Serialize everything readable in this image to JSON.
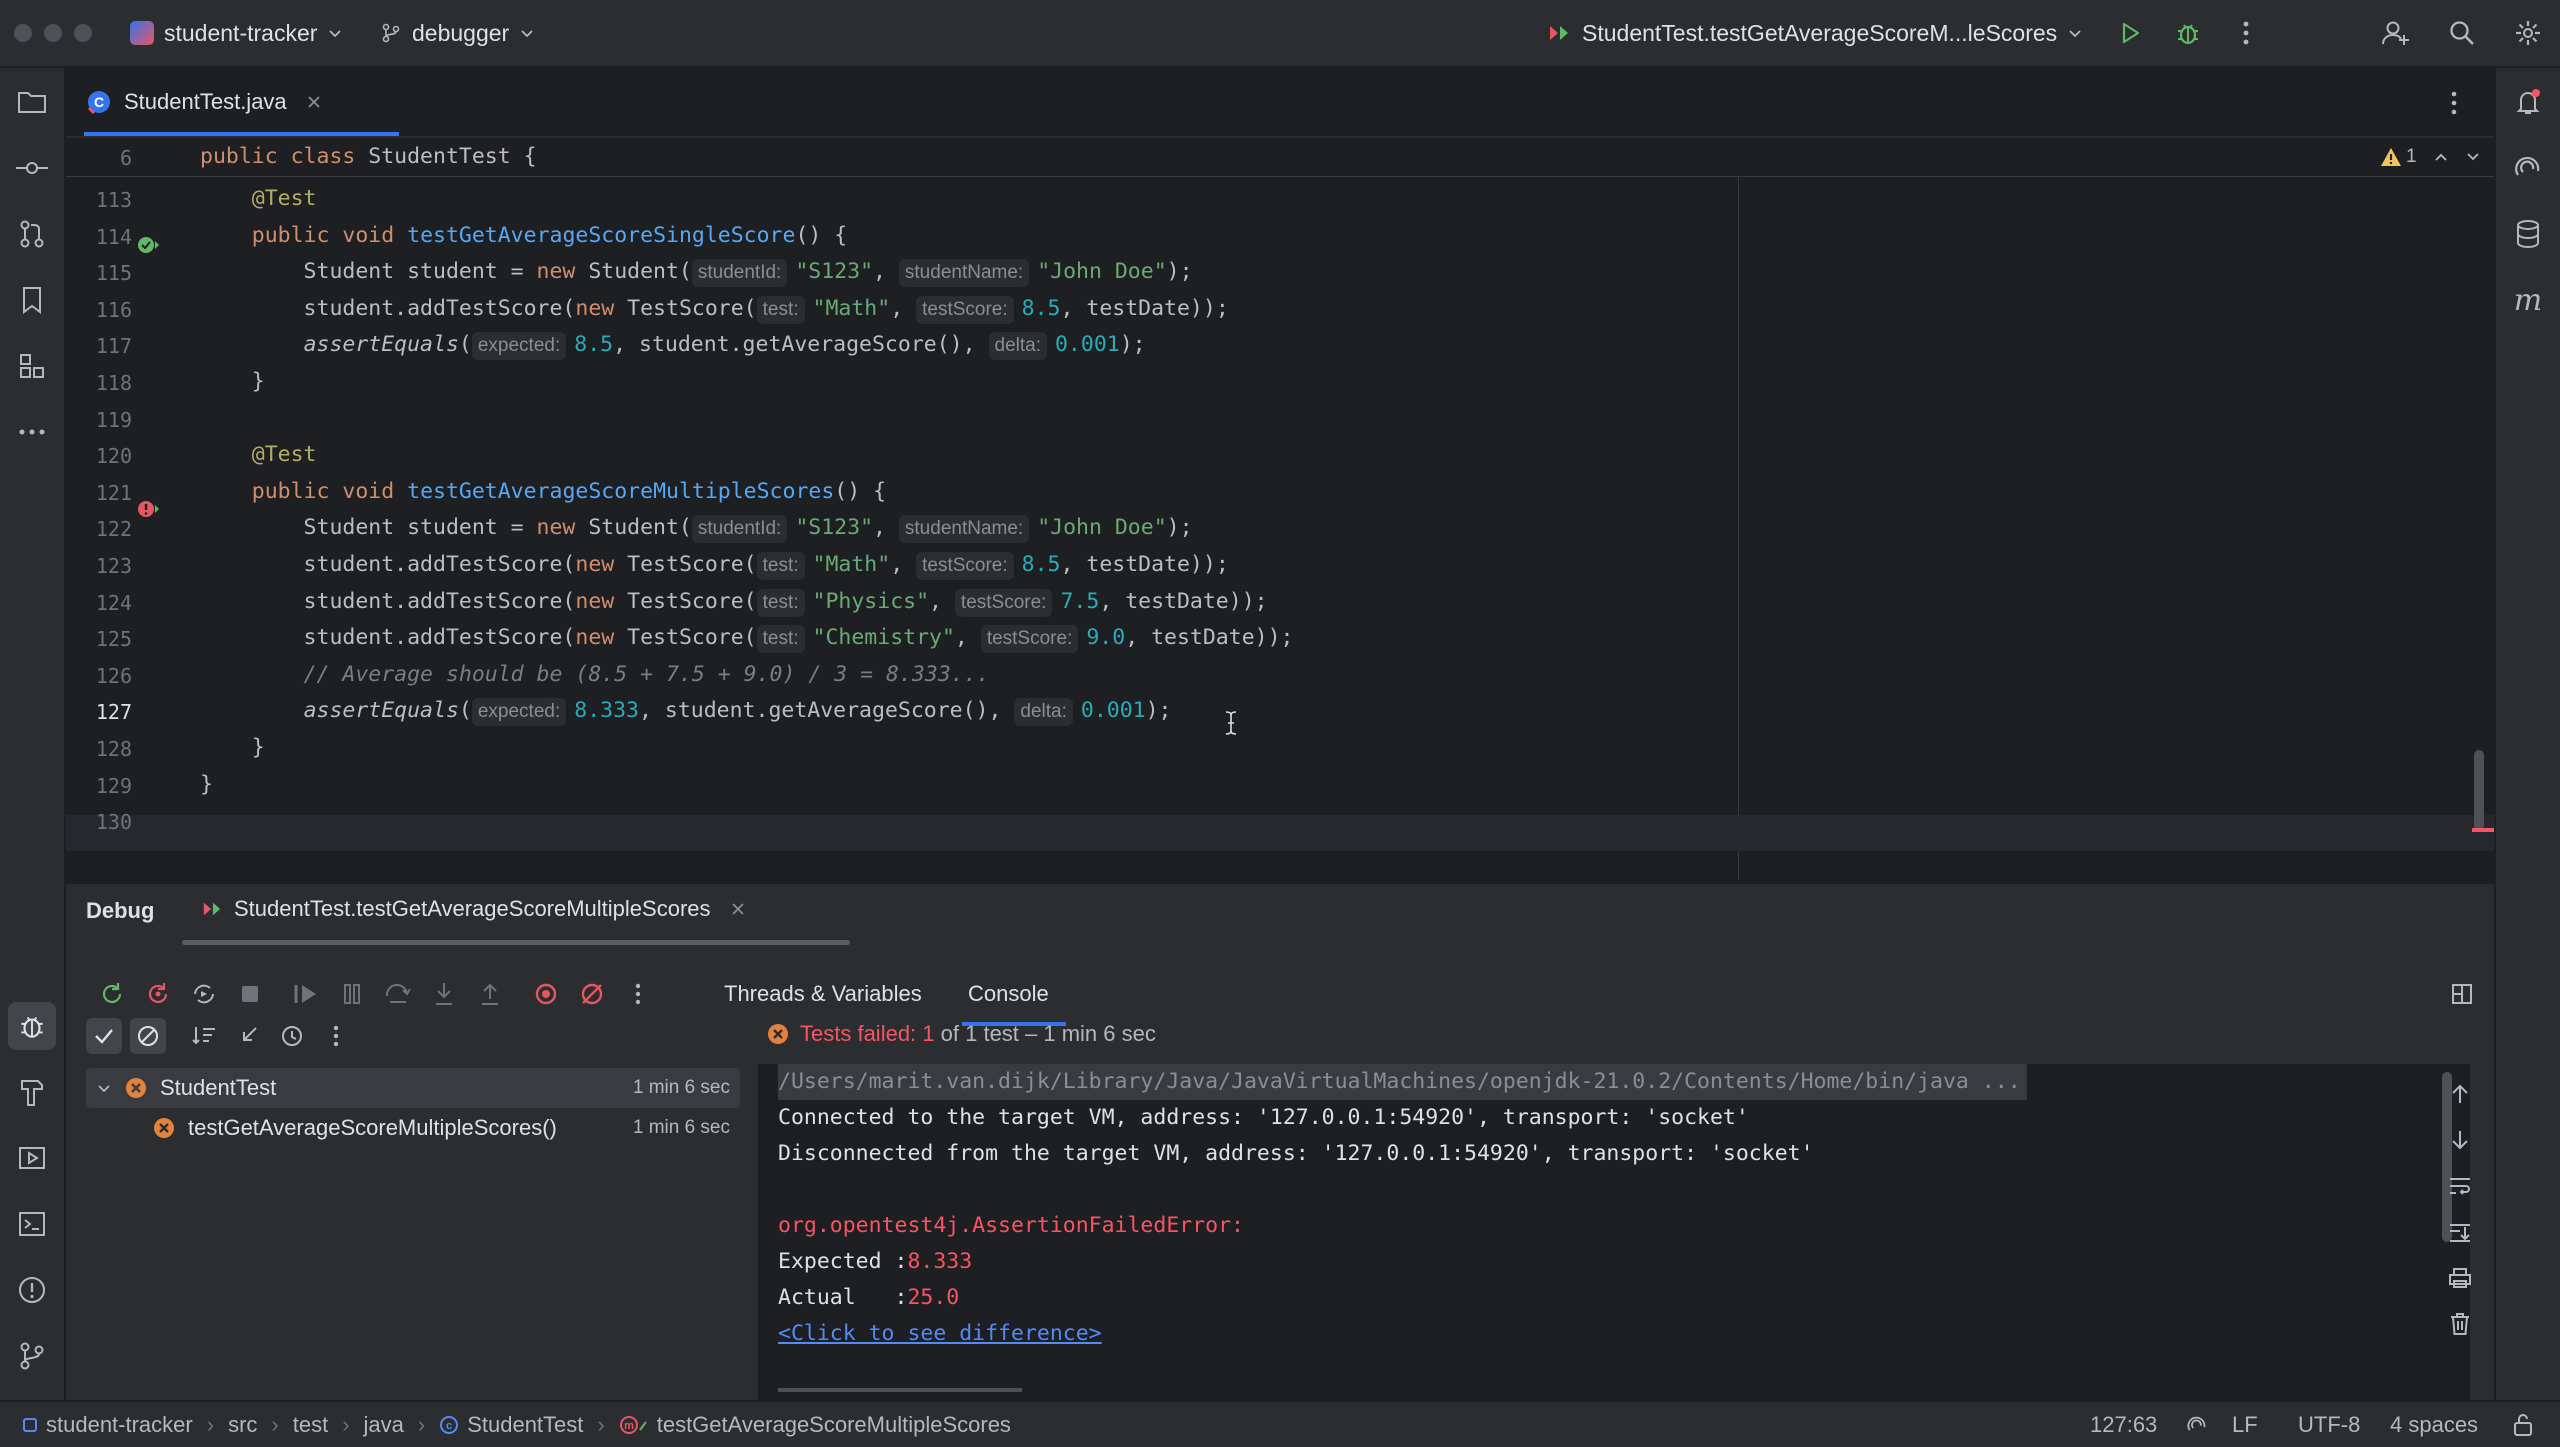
{
  "titlebar": {
    "project": "student-tracker",
    "project_badge": "ST",
    "branch": "debugger",
    "run_config": "StudentTest.testGetAverageScoreM...leScores"
  },
  "editor_tab": {
    "filename": "StudentTest.java"
  },
  "editor": {
    "sticky_line_number": "6",
    "sticky_code": [
      {
        "t": "public ",
        "c": "kw"
      },
      {
        "t": "class ",
        "c": "kw"
      },
      {
        "t": "StudentTest {",
        "c": ""
      }
    ],
    "problems_count": "1",
    "lines": [
      {
        "n": "113",
        "tokens": [
          {
            "t": "    "
          },
          {
            "t": "@Test",
            "c": "ann"
          }
        ]
      },
      {
        "n": "114",
        "tokens": [
          {
            "t": "    "
          },
          {
            "t": "public ",
            "c": "kw"
          },
          {
            "t": "void ",
            "c": "kw"
          },
          {
            "t": "testGetAverageScoreSingleScore",
            "c": "fn"
          },
          {
            "t": "() {"
          }
        ]
      },
      {
        "n": "115",
        "tokens": [
          {
            "t": "        Student student = "
          },
          {
            "t": "new ",
            "c": "kw"
          },
          {
            "t": "Student("
          },
          {
            "h": "studentId:"
          },
          {
            "t": "\"S123\"",
            "c": "str"
          },
          {
            "t": ", "
          },
          {
            "h": "studentName:"
          },
          {
            "t": "\"John Doe\"",
            "c": "str"
          },
          {
            "t": ");"
          }
        ]
      },
      {
        "n": "116",
        "tokens": [
          {
            "t": "        student.addTestScore("
          },
          {
            "t": "new ",
            "c": "kw"
          },
          {
            "t": "TestScore("
          },
          {
            "h": "test:"
          },
          {
            "t": "\"Math\"",
            "c": "str"
          },
          {
            "t": ", "
          },
          {
            "h": "testScore:"
          },
          {
            "t": "8.5",
            "c": "num"
          },
          {
            "t": ", testDate));"
          }
        ]
      },
      {
        "n": "117",
        "tokens": [
          {
            "t": "        "
          },
          {
            "t": "assertEquals",
            "c": "it"
          },
          {
            "t": "("
          },
          {
            "h": "expected:"
          },
          {
            "t": "8.5",
            "c": "num"
          },
          {
            "t": ", student.getAverageScore(), "
          },
          {
            "h": "delta:"
          },
          {
            "t": "0.001",
            "c": "num"
          },
          {
            "t": ");"
          }
        ]
      },
      {
        "n": "118",
        "tokens": [
          {
            "t": "    }"
          }
        ]
      },
      {
        "n": "119",
        "tokens": []
      },
      {
        "n": "120",
        "tokens": [
          {
            "t": "    "
          },
          {
            "t": "@Test",
            "c": "ann"
          }
        ]
      },
      {
        "n": "121",
        "tokens": [
          {
            "t": "    "
          },
          {
            "t": "public ",
            "c": "kw"
          },
          {
            "t": "void ",
            "c": "kw"
          },
          {
            "t": "testGetAverageScoreMultipleScores",
            "c": "fn"
          },
          {
            "t": "() {"
          }
        ]
      },
      {
        "n": "122",
        "tokens": [
          {
            "t": "        Student student = "
          },
          {
            "t": "new ",
            "c": "kw"
          },
          {
            "t": "Student("
          },
          {
            "h": "studentId:"
          },
          {
            "t": "\"S123\"",
            "c": "str"
          },
          {
            "t": ", "
          },
          {
            "h": "studentName:"
          },
          {
            "t": "\"John Doe\"",
            "c": "str"
          },
          {
            "t": ");"
          }
        ]
      },
      {
        "n": "123",
        "tokens": [
          {
            "t": "        student.addTestScore("
          },
          {
            "t": "new ",
            "c": "kw"
          },
          {
            "t": "TestScore("
          },
          {
            "h": "test:"
          },
          {
            "t": "\"Math\"",
            "c": "str"
          },
          {
            "t": ", "
          },
          {
            "h": "testScore:"
          },
          {
            "t": "8.5",
            "c": "num"
          },
          {
            "t": ", testDate));"
          }
        ]
      },
      {
        "n": "124",
        "tokens": [
          {
            "t": "        student.addTestScore("
          },
          {
            "t": "new ",
            "c": "kw"
          },
          {
            "t": "TestScore("
          },
          {
            "h": "test:"
          },
          {
            "t": "\"Physics\"",
            "c": "str"
          },
          {
            "t": ", "
          },
          {
            "h": "testScore:"
          },
          {
            "t": "7.5",
            "c": "num"
          },
          {
            "t": ", testDate));"
          }
        ]
      },
      {
        "n": "125",
        "tokens": [
          {
            "t": "        student.addTestScore("
          },
          {
            "t": "new ",
            "c": "kw"
          },
          {
            "t": "TestScore("
          },
          {
            "h": "test:"
          },
          {
            "t": "\"Chemistry\"",
            "c": "str"
          },
          {
            "t": ", "
          },
          {
            "h": "testScore:"
          },
          {
            "t": "9.0",
            "c": "num"
          },
          {
            "t": ", testDate));"
          }
        ]
      },
      {
        "n": "126",
        "tokens": [
          {
            "t": "        "
          },
          {
            "t": "// Average should be (8.5 + 7.5 + 9.0) / 3 = 8.333...",
            "c": "cm"
          }
        ]
      },
      {
        "n": "127",
        "tokens": [
          {
            "t": "        "
          },
          {
            "t": "assertEquals",
            "c": "it"
          },
          {
            "t": "("
          },
          {
            "h": "expected:"
          },
          {
            "t": "8.333",
            "c": "num"
          },
          {
            "t": ", student.getAverageScore(), "
          },
          {
            "h": "delta:"
          },
          {
            "t": "0.001",
            "c": "num"
          },
          {
            "t": ");"
          }
        ]
      },
      {
        "n": "128",
        "tokens": [
          {
            "t": "    }"
          }
        ]
      },
      {
        "n": "129",
        "tokens": [
          {
            "t": "}"
          }
        ]
      },
      {
        "n": "130",
        "tokens": []
      }
    ]
  },
  "debug": {
    "title": "Debug",
    "session_tab": "StudentTest.testGetAverageScoreMultipleScores",
    "tabs": [
      "Threads & Variables",
      "Console"
    ],
    "active_tab": "Console",
    "status_prefix": "Tests failed: ",
    "status_count": "1",
    "status_suffix": " of 1 test – 1 min 6 sec",
    "tree": [
      {
        "label": "StudentTest",
        "time": "1 min 6 sec"
      },
      {
        "label": "testGetAverageScoreMultipleScores()",
        "time": "1 min 6 sec"
      }
    ],
    "console": {
      "cmd": "/Users/marit.van.dijk/Library/Java/JavaVirtualMachines/openjdk-21.0.2/Contents/Home/bin/java ...",
      "connected": "Connected to the target VM, address: '127.0.0.1:54920', transport: 'socket'",
      "disconnected": "Disconnected from the target VM, address: '127.0.0.1:54920', transport: 'socket'",
      "error": "org.opentest4j.AssertionFailedError:",
      "expected_label": "Expected :",
      "expected_value": "8.333",
      "actual_label": "Actual   :",
      "actual_value": "25.0",
      "diff_link": "<Click to see difference>"
    }
  },
  "statusbar": {
    "breadcrumbs": [
      "student-tracker",
      "src",
      "test",
      "java",
      "StudentTest",
      "testGetAverageScoreMultipleScores"
    ],
    "caret": "127:63",
    "line_ending": "LF",
    "encoding": "UTF-8",
    "indent": "4 spaces"
  },
  "colors": {
    "accent": "#3574f0",
    "error": "#f75464",
    "success": "#5fb865",
    "background": "#1e1f22",
    "panel": "#2b2d30"
  }
}
